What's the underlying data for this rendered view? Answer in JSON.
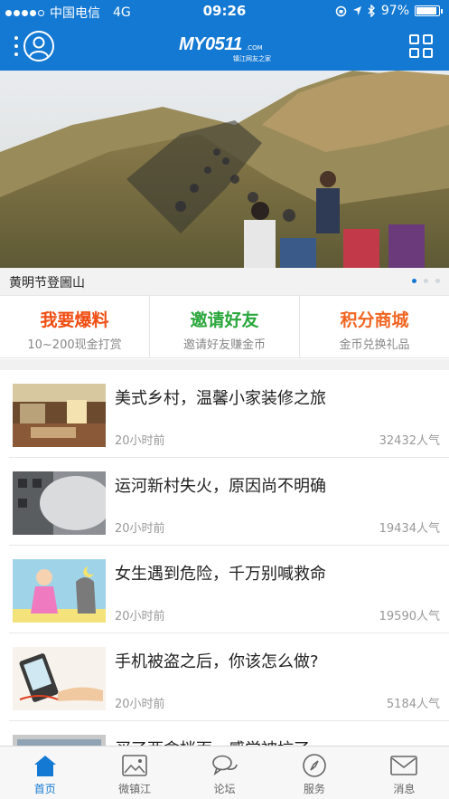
{
  "status_bar": {
    "carrier": "中国电信",
    "network": "4G",
    "time": "09:26",
    "battery": "97%"
  },
  "header": {
    "logo_brand": "MY0511",
    "logo_com": ".COM",
    "logo_sub": "镇江网友之家"
  },
  "banner": {
    "caption": "黄明节登圌山",
    "page_count": 3,
    "active_page": 1
  },
  "features": [
    {
      "title": "我要爆料",
      "subtitle": "10~200现金打赏"
    },
    {
      "title": "邀请好友",
      "subtitle": "邀请好友赚金币"
    },
    {
      "title": "积分商城",
      "subtitle": "金币兑换礼品"
    }
  ],
  "news": [
    {
      "title": "美式乡村，温馨小家装修之旅",
      "time": "20小时前",
      "views": "32432人气"
    },
    {
      "title": "运河新村失火，原因尚不明确",
      "time": "20小时前",
      "views": "19434人气"
    },
    {
      "title": "女生遇到危险，千万别喊救命",
      "time": "20小时前",
      "views": "19590人气"
    },
    {
      "title": "手机被盗之后，你该怎么做?",
      "time": "20小时前",
      "views": "5184人气"
    },
    {
      "title": "买了两盒拌面，感觉被坑了",
      "time": "",
      "views": ""
    }
  ],
  "tabs": [
    {
      "label": "首页",
      "icon": "home-icon",
      "active": true
    },
    {
      "label": "微镇江",
      "icon": "image-icon",
      "active": false
    },
    {
      "label": "论坛",
      "icon": "chat-icon",
      "active": false
    },
    {
      "label": "服务",
      "icon": "compass-icon",
      "active": false
    },
    {
      "label": "消息",
      "icon": "mail-icon",
      "active": false
    }
  ],
  "colors": {
    "primary": "#1479d3",
    "red": "#f04d12",
    "green": "#2aa73c",
    "orange": "#f26522"
  }
}
